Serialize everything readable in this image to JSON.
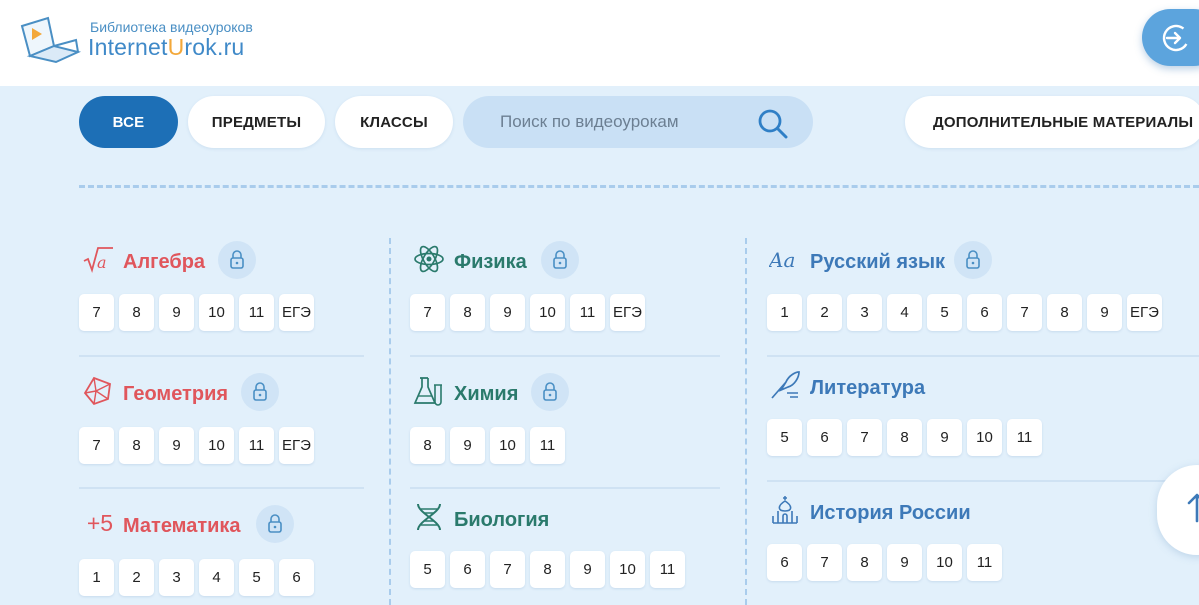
{
  "logo": {
    "tagline": "Библиотека видеоуроков",
    "brand_part1": "Internet",
    "brand_part2": "U",
    "brand_part3": "rok.ru"
  },
  "colors": {
    "primary": "#1d6fb6",
    "background": "#e2f0fb",
    "subject_red": "#e0565c",
    "subject_green": "#2a7a6c",
    "subject_blue": "#3d79b8",
    "accent_orange": "#f3a83a"
  },
  "nav": {
    "all": "ВСЕ",
    "subjects": "ПРЕДМЕТЫ",
    "classes": "КЛАССЫ",
    "extra": "ДОПОЛНИТЕЛЬНЫЕ МАТЕРИАЛЫ"
  },
  "search": {
    "placeholder": "Поиск по видеоурокам",
    "icon": "search-icon"
  },
  "subjects": {
    "algebra": {
      "name": "Алгебра",
      "icon": "sqrt-icon",
      "locked": true,
      "grades": [
        "7",
        "8",
        "9",
        "10",
        "11",
        "ЕГЭ"
      ]
    },
    "geometry": {
      "name": "Геометрия",
      "icon": "polyhedron-icon",
      "locked": true,
      "grades": [
        "7",
        "8",
        "9",
        "10",
        "11",
        "ЕГЭ"
      ]
    },
    "math": {
      "name": "Математика",
      "icon": "plus-five-icon",
      "icon_text": "+5",
      "locked": true,
      "grades": [
        "1",
        "2",
        "3",
        "4",
        "5",
        "6"
      ]
    },
    "physics": {
      "name": "Физика",
      "icon": "atom-icon",
      "locked": true,
      "grades": [
        "7",
        "8",
        "9",
        "10",
        "11",
        "ЕГЭ"
      ]
    },
    "chemistry": {
      "name": "Химия",
      "icon": "flask-icon",
      "locked": true,
      "grades": [
        "8",
        "9",
        "10",
        "11"
      ]
    },
    "biology": {
      "name": "Биология",
      "icon": "dna-icon",
      "locked": false,
      "grades": [
        "5",
        "6",
        "7",
        "8",
        "9",
        "10",
        "11"
      ]
    },
    "russian": {
      "name": "Русский язык",
      "icon": "letters-aa-icon",
      "locked": true,
      "grades": [
        "1",
        "2",
        "3",
        "4",
        "5",
        "6",
        "7",
        "8",
        "9",
        "ЕГЭ"
      ]
    },
    "literature": {
      "name": "Литература",
      "icon": "quill-icon",
      "locked": false,
      "grades": [
        "5",
        "6",
        "7",
        "8",
        "9",
        "10",
        "11"
      ]
    },
    "history": {
      "name": "История России",
      "icon": "church-icon",
      "locked": false,
      "grades": [
        "6",
        "7",
        "8",
        "9",
        "10",
        "11"
      ]
    }
  }
}
